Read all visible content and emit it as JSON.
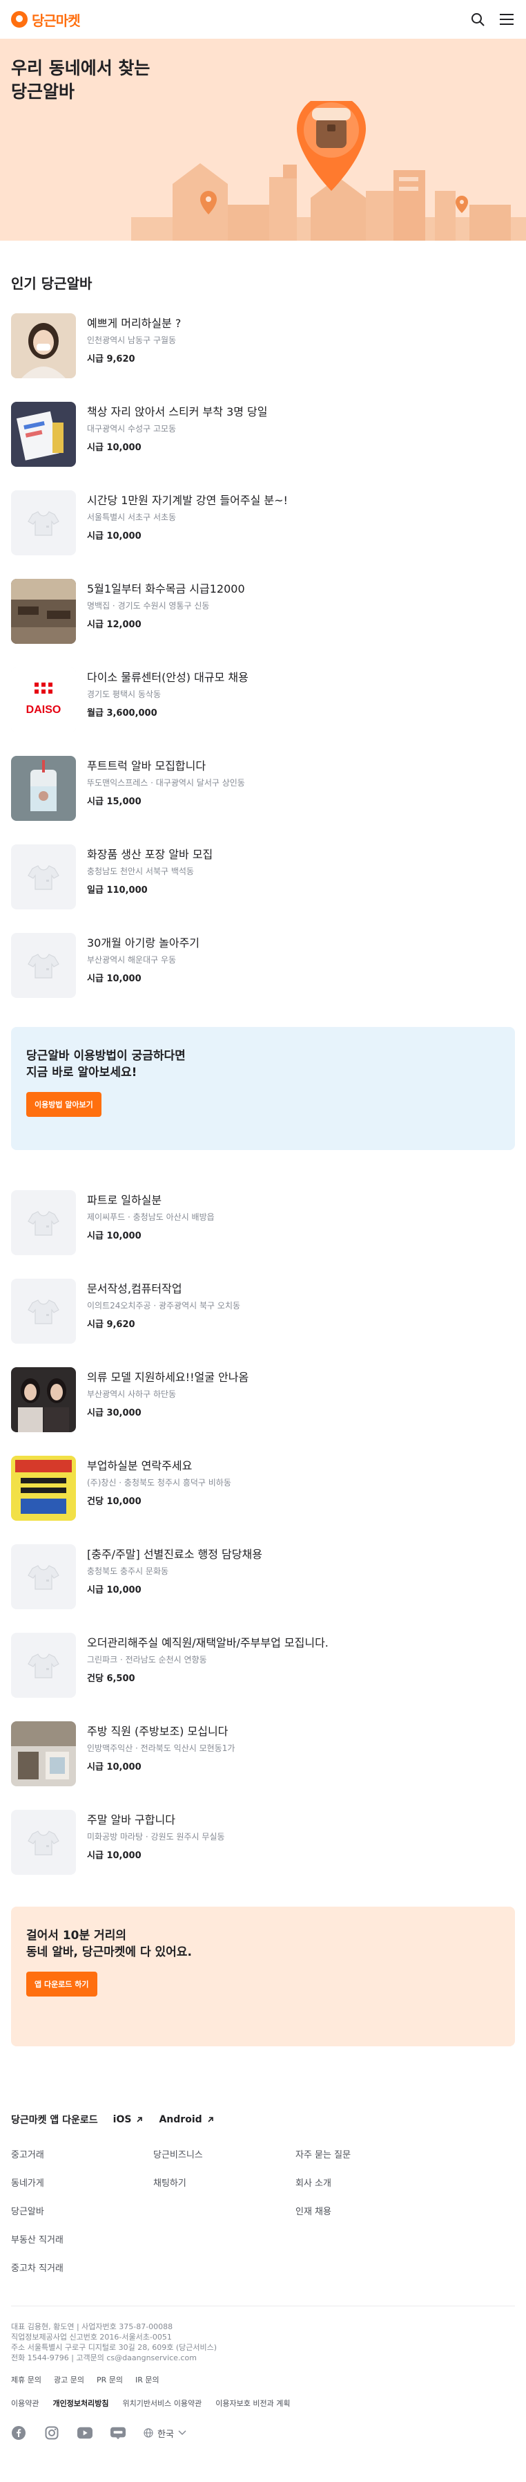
{
  "header": {
    "logo_text": "당근마켓",
    "search_icon": "search-icon",
    "menu_icon": "menu-icon"
  },
  "hero": {
    "line1": "우리 동네에서 찾는",
    "line2": "당근알바"
  },
  "popular": {
    "title": "인기 당근알바",
    "jobs_a": [
      {
        "title": "예쁘게 머리하실분 ?",
        "meta": "인천광역시 남동구 구월동",
        "pay": "시급 9,620",
        "thumb": "photo-woman"
      },
      {
        "title": "책상 자리 앉아서 스티커 부착 3명 당일",
        "meta": "대구광역시 수성구 고모동",
        "pay": "시급 10,000",
        "thumb": "photo-stickers"
      },
      {
        "title": "시간당 1만원 자기계발 강연 들어주실 분~!",
        "meta": "서울특별시 서초구 서초동",
        "pay": "시급 10,000",
        "thumb": "default"
      },
      {
        "title": "5월1일부터 화수목금 시급12000",
        "meta": "명백집 · 경기도 수원시 영통구 신동",
        "pay": "시급 12,000",
        "thumb": "photo-restaurant"
      },
      {
        "title": "다이소 물류센터(안성) 대규모 채용",
        "meta": "경기도 평택시 동삭동",
        "pay": "월급 3,600,000",
        "thumb": "daiso"
      },
      {
        "title": "푸트트럭 알바 모집합니다",
        "meta": "뚜도맨익스프레스 · 대구광역시 달서구 상인동",
        "pay": "시급 15,000",
        "thumb": "photo-drink"
      },
      {
        "title": "화장품 생산 포장 알바 모집",
        "meta": "충청남도 천안시 서북구 백석동",
        "pay": "일급 110,000",
        "thumb": "default"
      },
      {
        "title": "30개월 아기랑 놀아주기",
        "meta": "부산광역시 해운대구 우동",
        "pay": "시급 10,000",
        "thumb": "default"
      }
    ],
    "jobs_b": [
      {
        "title": "파트로 일하실분",
        "meta": "제이씨푸드 · 충청남도 아산시 배방읍",
        "pay": "시급 10,000",
        "thumb": "default"
      },
      {
        "title": "문서작성,컴퓨터작업",
        "meta": "이의트24오치주공 · 광주광역시 북구 오치동",
        "pay": "시급 9,620",
        "thumb": "default"
      },
      {
        "title": "의류 모델 지원하세요!!얼굴 안나옴",
        "meta": "부산광역시 사하구 하단동",
        "pay": "시급 30,000",
        "thumb": "photo-models"
      },
      {
        "title": "부업하실분 연락주세요",
        "meta": "(주)창신 · 충청북도 청주시 흥덕구 비하동",
        "pay": "건당 10,000",
        "thumb": "photo-sign"
      },
      {
        "title": "[충주/주말] 선별진료소 행정 담당채용",
        "meta": "충청북도 충주시 문화동",
        "pay": "시급 10,000",
        "thumb": "default"
      },
      {
        "title": "오더관리해주실 예직원/재택알바/주부부업 모집니다.",
        "meta": "그린파크 · 전라남도 순천시 연향동",
        "pay": "건당 6,500",
        "thumb": "default"
      },
      {
        "title": "주방 직원 (주방보조) 모십니다",
        "meta": "인방맥주익산 · 전라북도 익산시 모현동1가",
        "pay": "시급 10,000",
        "thumb": "photo-building"
      },
      {
        "title": "주말 알바 구합니다",
        "meta": "미화공방 마라탕 · 강원도 원주시 무실동",
        "pay": "시급 10,000",
        "thumb": "default"
      }
    ]
  },
  "banner_help": {
    "line1": "당근알바 이용방법이 궁금하다면",
    "line2": "지금 바로 알아보세요!",
    "button": "이용방법 알아보기"
  },
  "banner_app": {
    "line1": "걸어서 10분 거리의",
    "line2": "동네 알바, 당근마켓에 다 있어요.",
    "button": "앱 다운로드 하기"
  },
  "footer": {
    "app_download": "당근마켓 앱 다운로드",
    "ios": "iOS",
    "android": "Android",
    "links": [
      "중고거래",
      "당근비즈니스",
      "자주 묻는 질문",
      "동네가게",
      "채팅하기",
      "회사 소개",
      "당근알바",
      "",
      "인재 채용",
      "부동산 직거래",
      "",
      "",
      "중고차 직거래",
      "",
      ""
    ],
    "company": [
      "대표 김용현, 황도연 | 사업자번호 375-87-00088",
      "직업정보제공사업 신고번호 2016-서울서초-0051",
      "주소 서울특별시 구로구 디지털로 30길 28, 609호 (당근서비스)",
      "전화 1544-9796 | 고객문의 cs@daangnservice.com"
    ],
    "links_row1": [
      "제휴 문의",
      "광고 문의",
      "PR 문의",
      "IR 문의"
    ],
    "links_row2": [
      "이용약관",
      "개인정보처리방침",
      "위치기반서비스 이용약관",
      "이용자보호 비전과 계획"
    ],
    "language": "한국"
  },
  "colors": {
    "brand": "#ff6f0f",
    "hero_bg": "#ffe2cf",
    "help_banner_bg": "#e7f3fb",
    "app_banner_bg": "#ffeadb"
  }
}
